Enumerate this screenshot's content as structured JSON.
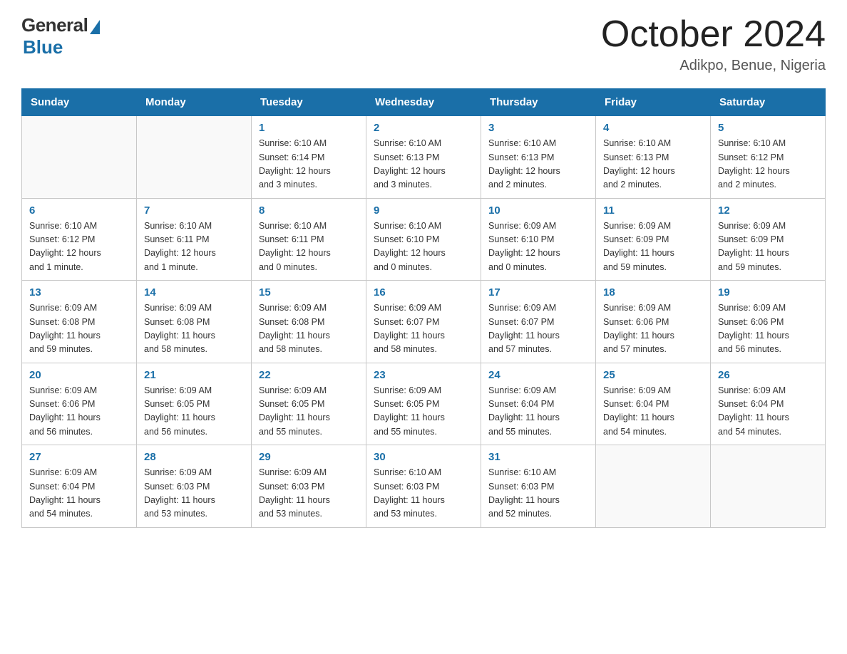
{
  "header": {
    "logo_general": "General",
    "logo_blue": "Blue",
    "title": "October 2024",
    "subtitle": "Adikpo, Benue, Nigeria"
  },
  "weekdays": [
    "Sunday",
    "Monday",
    "Tuesday",
    "Wednesday",
    "Thursday",
    "Friday",
    "Saturday"
  ],
  "weeks": [
    [
      {
        "day": "",
        "info": ""
      },
      {
        "day": "",
        "info": ""
      },
      {
        "day": "1",
        "info": "Sunrise: 6:10 AM\nSunset: 6:14 PM\nDaylight: 12 hours\nand 3 minutes."
      },
      {
        "day": "2",
        "info": "Sunrise: 6:10 AM\nSunset: 6:13 PM\nDaylight: 12 hours\nand 3 minutes."
      },
      {
        "day": "3",
        "info": "Sunrise: 6:10 AM\nSunset: 6:13 PM\nDaylight: 12 hours\nand 2 minutes."
      },
      {
        "day": "4",
        "info": "Sunrise: 6:10 AM\nSunset: 6:13 PM\nDaylight: 12 hours\nand 2 minutes."
      },
      {
        "day": "5",
        "info": "Sunrise: 6:10 AM\nSunset: 6:12 PM\nDaylight: 12 hours\nand 2 minutes."
      }
    ],
    [
      {
        "day": "6",
        "info": "Sunrise: 6:10 AM\nSunset: 6:12 PM\nDaylight: 12 hours\nand 1 minute."
      },
      {
        "day": "7",
        "info": "Sunrise: 6:10 AM\nSunset: 6:11 PM\nDaylight: 12 hours\nand 1 minute."
      },
      {
        "day": "8",
        "info": "Sunrise: 6:10 AM\nSunset: 6:11 PM\nDaylight: 12 hours\nand 0 minutes."
      },
      {
        "day": "9",
        "info": "Sunrise: 6:10 AM\nSunset: 6:10 PM\nDaylight: 12 hours\nand 0 minutes."
      },
      {
        "day": "10",
        "info": "Sunrise: 6:09 AM\nSunset: 6:10 PM\nDaylight: 12 hours\nand 0 minutes."
      },
      {
        "day": "11",
        "info": "Sunrise: 6:09 AM\nSunset: 6:09 PM\nDaylight: 11 hours\nand 59 minutes."
      },
      {
        "day": "12",
        "info": "Sunrise: 6:09 AM\nSunset: 6:09 PM\nDaylight: 11 hours\nand 59 minutes."
      }
    ],
    [
      {
        "day": "13",
        "info": "Sunrise: 6:09 AM\nSunset: 6:08 PM\nDaylight: 11 hours\nand 59 minutes."
      },
      {
        "day": "14",
        "info": "Sunrise: 6:09 AM\nSunset: 6:08 PM\nDaylight: 11 hours\nand 58 minutes."
      },
      {
        "day": "15",
        "info": "Sunrise: 6:09 AM\nSunset: 6:08 PM\nDaylight: 11 hours\nand 58 minutes."
      },
      {
        "day": "16",
        "info": "Sunrise: 6:09 AM\nSunset: 6:07 PM\nDaylight: 11 hours\nand 58 minutes."
      },
      {
        "day": "17",
        "info": "Sunrise: 6:09 AM\nSunset: 6:07 PM\nDaylight: 11 hours\nand 57 minutes."
      },
      {
        "day": "18",
        "info": "Sunrise: 6:09 AM\nSunset: 6:06 PM\nDaylight: 11 hours\nand 57 minutes."
      },
      {
        "day": "19",
        "info": "Sunrise: 6:09 AM\nSunset: 6:06 PM\nDaylight: 11 hours\nand 56 minutes."
      }
    ],
    [
      {
        "day": "20",
        "info": "Sunrise: 6:09 AM\nSunset: 6:06 PM\nDaylight: 11 hours\nand 56 minutes."
      },
      {
        "day": "21",
        "info": "Sunrise: 6:09 AM\nSunset: 6:05 PM\nDaylight: 11 hours\nand 56 minutes."
      },
      {
        "day": "22",
        "info": "Sunrise: 6:09 AM\nSunset: 6:05 PM\nDaylight: 11 hours\nand 55 minutes."
      },
      {
        "day": "23",
        "info": "Sunrise: 6:09 AM\nSunset: 6:05 PM\nDaylight: 11 hours\nand 55 minutes."
      },
      {
        "day": "24",
        "info": "Sunrise: 6:09 AM\nSunset: 6:04 PM\nDaylight: 11 hours\nand 55 minutes."
      },
      {
        "day": "25",
        "info": "Sunrise: 6:09 AM\nSunset: 6:04 PM\nDaylight: 11 hours\nand 54 minutes."
      },
      {
        "day": "26",
        "info": "Sunrise: 6:09 AM\nSunset: 6:04 PM\nDaylight: 11 hours\nand 54 minutes."
      }
    ],
    [
      {
        "day": "27",
        "info": "Sunrise: 6:09 AM\nSunset: 6:04 PM\nDaylight: 11 hours\nand 54 minutes."
      },
      {
        "day": "28",
        "info": "Sunrise: 6:09 AM\nSunset: 6:03 PM\nDaylight: 11 hours\nand 53 minutes."
      },
      {
        "day": "29",
        "info": "Sunrise: 6:09 AM\nSunset: 6:03 PM\nDaylight: 11 hours\nand 53 minutes."
      },
      {
        "day": "30",
        "info": "Sunrise: 6:10 AM\nSunset: 6:03 PM\nDaylight: 11 hours\nand 53 minutes."
      },
      {
        "day": "31",
        "info": "Sunrise: 6:10 AM\nSunset: 6:03 PM\nDaylight: 11 hours\nand 52 minutes."
      },
      {
        "day": "",
        "info": ""
      },
      {
        "day": "",
        "info": ""
      }
    ]
  ]
}
